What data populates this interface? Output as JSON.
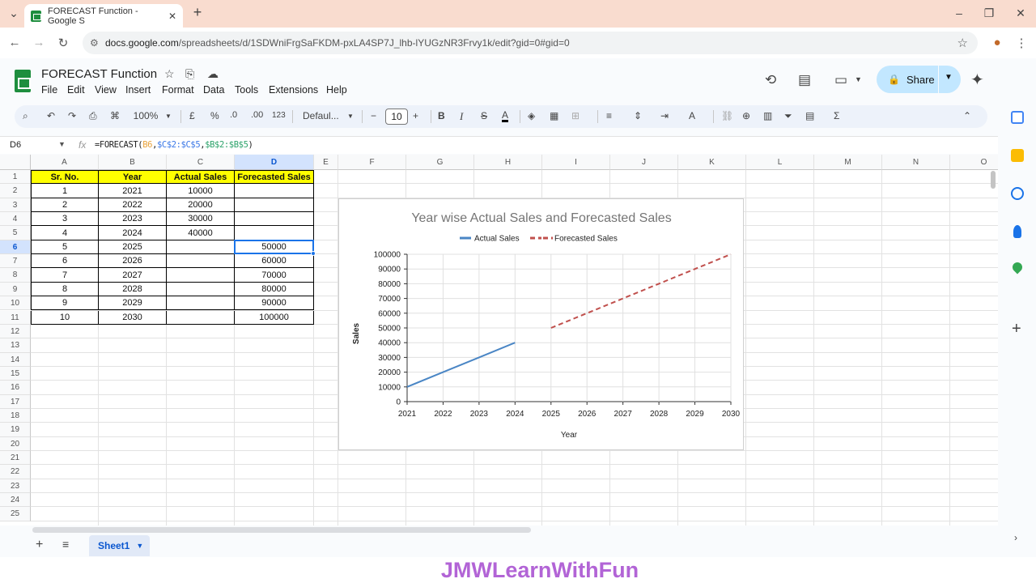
{
  "browser": {
    "tab_title": "FORECAST Function - Google S",
    "url_host": "docs.google.com",
    "url_path": "/spreadsheets/d/1SDWniFrgSaFKDM-pxLA4SP7J_lhb-lYUGzNR3Frvy1k/edit?gid=0#gid=0"
  },
  "doc": {
    "title": "FORECAST Function",
    "menu": [
      "File",
      "Edit",
      "View",
      "Insert",
      "Format",
      "Data",
      "Tools",
      "Extensions",
      "Help"
    ],
    "share_label": "Share"
  },
  "toolbar": {
    "zoom": "100%",
    "currency": "£",
    "percent": "%",
    "dec_decrease": ".0",
    "dec_increase": ".00",
    "number_format": "123",
    "font": "Defaul...",
    "font_size": "10"
  },
  "formula_bar": {
    "name_box": "D6",
    "fx": "fx",
    "formula_prefix": "=FORECAST(",
    "arg1": "B6",
    "sep1": ",",
    "arg2": "$C$2:$C$5",
    "sep2": ",",
    "arg3": "$B$2:$B$5",
    "formula_suffix": ")"
  },
  "columns": [
    "A",
    "B",
    "C",
    "D",
    "E",
    "F",
    "G",
    "H",
    "I",
    "J",
    "K",
    "L",
    "M",
    "N",
    "O"
  ],
  "rows": [
    "1",
    "2",
    "3",
    "4",
    "5",
    "6",
    "7",
    "8",
    "9",
    "10",
    "11",
    "12",
    "13",
    "14",
    "15",
    "16",
    "17",
    "18",
    "19",
    "20",
    "21",
    "22",
    "23",
    "24",
    "25"
  ],
  "table": {
    "headers": [
      "Sr. No.",
      "Year",
      "Actual Sales",
      "Forecasted Sales"
    ],
    "rows": [
      [
        "1",
        "2021",
        "10000",
        ""
      ],
      [
        "2",
        "2022",
        "20000",
        ""
      ],
      [
        "3",
        "2023",
        "30000",
        ""
      ],
      [
        "4",
        "2024",
        "40000",
        ""
      ],
      [
        "5",
        "2025",
        "",
        "50000"
      ],
      [
        "6",
        "2026",
        "",
        "60000"
      ],
      [
        "7",
        "2027",
        "",
        "70000"
      ],
      [
        "8",
        "2028",
        "",
        "80000"
      ],
      [
        "9",
        "2029",
        "",
        "90000"
      ],
      [
        "10",
        "2030",
        "",
        "100000"
      ]
    ]
  },
  "chart_data": {
    "type": "line",
    "title": "Year wise Actual Sales and Forecasted Sales",
    "xlabel": "Year",
    "ylabel": "Sales",
    "categories": [
      "2021",
      "2022",
      "2023",
      "2024",
      "2025",
      "2026",
      "2027",
      "2028",
      "2029",
      "2030"
    ],
    "yticks": [
      "0",
      "10000",
      "20000",
      "30000",
      "40000",
      "50000",
      "60000",
      "70000",
      "80000",
      "90000",
      "100000"
    ],
    "ylim": [
      0,
      100000
    ],
    "legend_position": "top",
    "grid": true,
    "series": [
      {
        "name": "Actual Sales",
        "color": "#4a86c5",
        "dashed": false,
        "values": [
          10000,
          20000,
          30000,
          40000,
          null,
          null,
          null,
          null,
          null,
          null
        ]
      },
      {
        "name": "Forecasted Sales",
        "color": "#c0504d",
        "dashed": true,
        "values": [
          null,
          null,
          null,
          null,
          50000,
          60000,
          70000,
          80000,
          90000,
          100000
        ]
      }
    ]
  },
  "sheet_tab": {
    "label": "Sheet1"
  },
  "watermark": "JMWLearnWithFun",
  "colors": {
    "header_fill": "#ffff00",
    "selection": "#1a73e8",
    "share_bg": "#c2e7ff",
    "watermark": "#b264d6"
  }
}
